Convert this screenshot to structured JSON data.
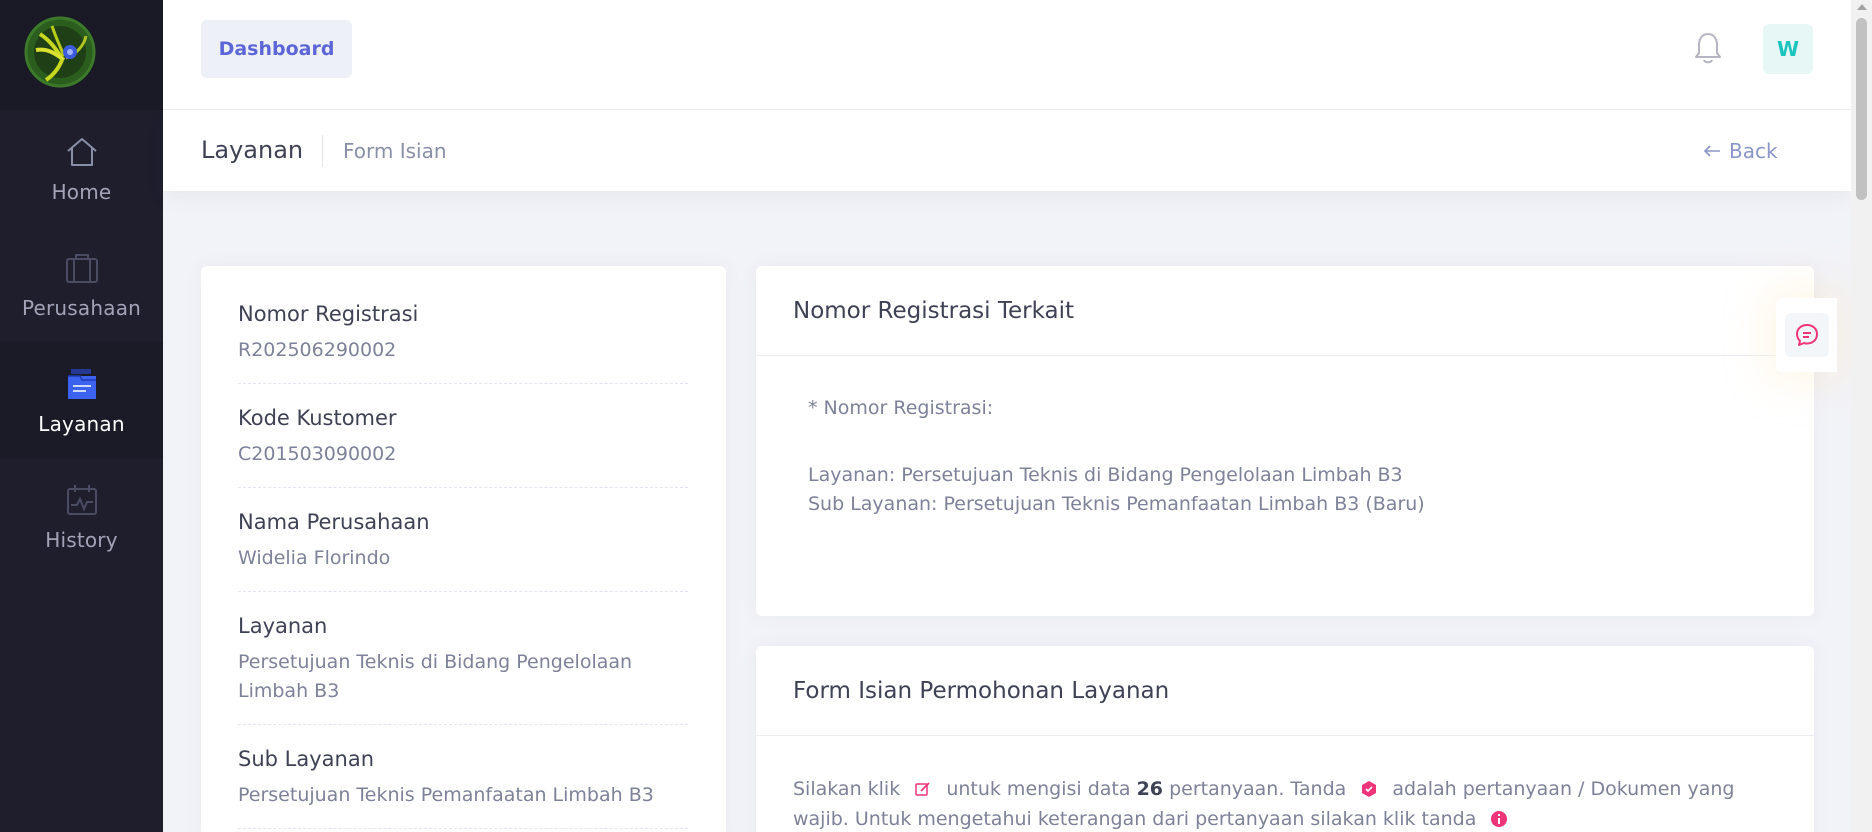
{
  "sidebar": {
    "logo_alt": "logo",
    "items": [
      {
        "label": "Home",
        "icon": "home-icon"
      },
      {
        "label": "Perusahaan",
        "icon": "briefcase-icon"
      },
      {
        "label": "Layanan",
        "icon": "document-stack-icon",
        "active": true
      },
      {
        "label": "History",
        "icon": "activity-chart-icon"
      }
    ]
  },
  "header": {
    "dashboard_label": "Dashboard",
    "avatar_initial": "W"
  },
  "subheader": {
    "title": "Layanan",
    "breadcrumb": "Form Isian",
    "back_label": "Back"
  },
  "info": {
    "nomor_registrasi": {
      "label": "Nomor Registrasi",
      "value": "R202506290002"
    },
    "kode_kustomer": {
      "label": "Kode Kustomer",
      "value": "C201503090002"
    },
    "nama_perusahaan": {
      "label": "Nama Perusahaan",
      "value": "Widelia Florindo"
    },
    "layanan": {
      "label": "Layanan",
      "value": "Persetujuan Teknis di Bidang Pengelolaan Limbah B3"
    },
    "sub_layanan": {
      "label": "Sub Layanan",
      "value": "Persetujuan Teknis Pemanfaatan Limbah B3"
    }
  },
  "registrasi_terkait": {
    "title": "Nomor Registrasi Terkait",
    "nomor_label": "* Nomor Registrasi:",
    "layanan_line": "Layanan: Persetujuan Teknis di Bidang Pengelolaan Limbah B3",
    "sub_layanan_line": "Sub Layanan: Persetujuan Teknis Pemanfaatan Limbah B3 (Baru)"
  },
  "form_isian": {
    "title": "Form Isian Permohonan Layanan",
    "text_1": "Silakan klik",
    "text_2": "untuk mengisi data",
    "question_count": "26",
    "text_3": "pertanyaan. Tanda",
    "text_4": "adalah pertanyaan / Dokumen yang wajib. Untuk mengetahui keterangan dari pertanyaan silakan klik tanda"
  },
  "colors": {
    "sidebar_bg": "#1e1e2d",
    "accent": "#5d66d6",
    "teal": "#1bc5bd",
    "pink": "#f0347a"
  }
}
